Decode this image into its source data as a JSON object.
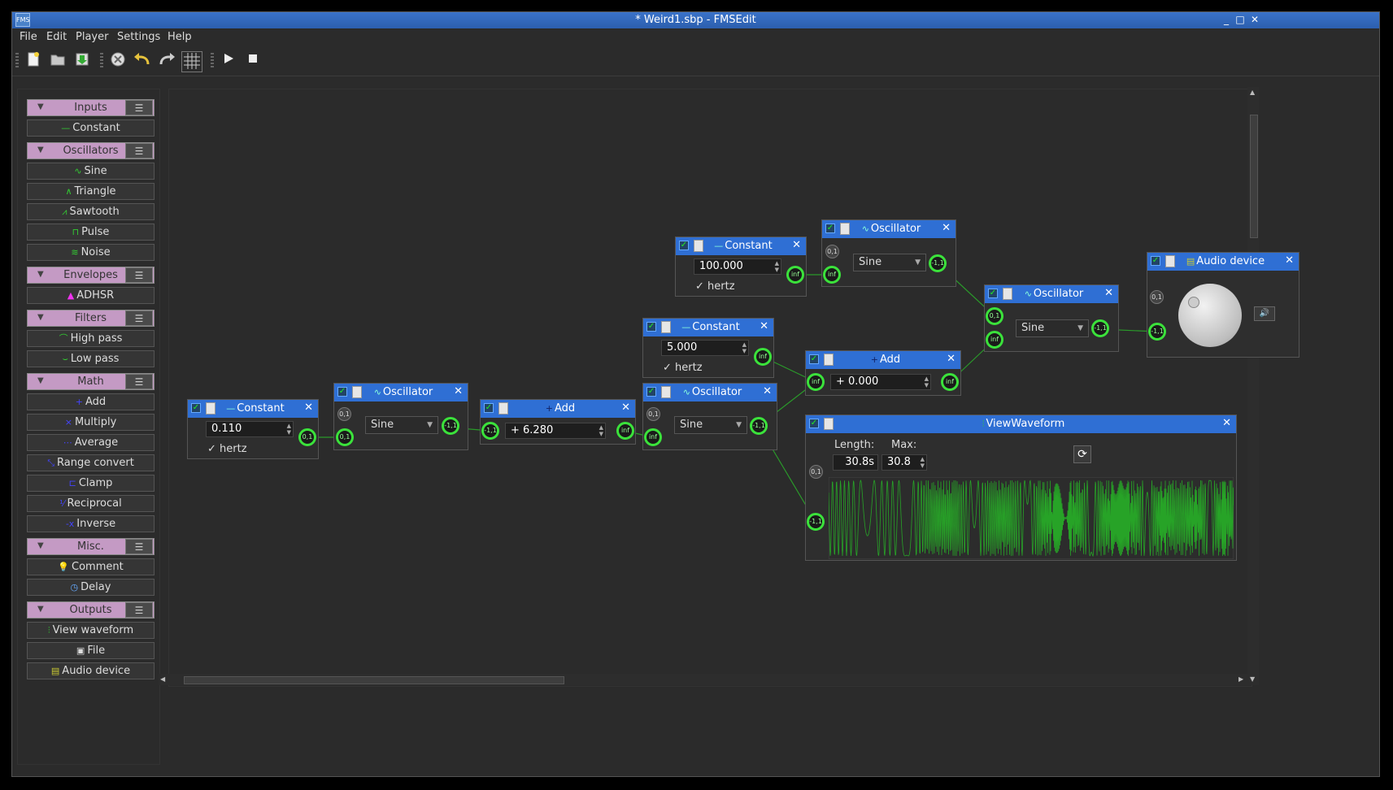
{
  "window": {
    "title": "* Weird1.sbp - FMSEdit",
    "app_icon": "fms-app-icon",
    "minimize": "_",
    "maximize": "□",
    "close": "✕"
  },
  "menu": [
    "File",
    "Edit",
    "Player",
    "Settings",
    "Help"
  ],
  "toolbar": {
    "icons": [
      "new-file-icon",
      "open-folder-icon",
      "save-icon",
      "delete-icon",
      "undo-icon",
      "redo-icon",
      "grid-icon",
      "play-icon",
      "stop-icon"
    ]
  },
  "sidebar": {
    "categories": [
      {
        "label": "Inputs",
        "items": [
          "Constant"
        ]
      },
      {
        "label": "Oscillators",
        "items": [
          "Sine",
          "Triangle",
          "Sawtooth",
          "Pulse",
          "Noise"
        ]
      },
      {
        "label": "Envelopes",
        "items": [
          "ADHSR"
        ]
      },
      {
        "label": "Filters",
        "items": [
          "High pass",
          "Low pass"
        ]
      },
      {
        "label": "Math",
        "items": [
          "Add",
          "Multiply",
          "Average",
          "Range convert",
          "Clamp",
          "Reciprocal",
          "Inverse"
        ]
      },
      {
        "label": "Misc.",
        "items": [
          "Comment",
          "Delay"
        ]
      },
      {
        "label": "Outputs",
        "items": [
          "View waveform",
          "File",
          "Audio device"
        ]
      }
    ]
  },
  "nodes": {
    "constant1": {
      "title": "Constant",
      "value": "0.110",
      "unit": "hertz",
      "out_port": "0,1"
    },
    "osc1": {
      "title": "Oscillator",
      "wave": "Sine",
      "in_port1": "0,1",
      "in_port2": "0,1",
      "out_port": "-1,1"
    },
    "add1": {
      "title": "Add",
      "value": "+ 6.280",
      "in_port": "-1,1",
      "out_port": "inf"
    },
    "constant2": {
      "title": "Constant",
      "value": "5.000",
      "unit": "hertz",
      "out_port": "inf"
    },
    "osc2": {
      "title": "Oscillator",
      "wave": "Sine",
      "in_port1": "0,1",
      "in_port2": "inf",
      "out_port": "-1,1"
    },
    "constant3": {
      "title": "Constant",
      "value": "100.000",
      "unit": "hertz",
      "out_port": "inf"
    },
    "osc3": {
      "title": "Oscillator",
      "wave": "Sine",
      "in_port1": "0,1",
      "in_port2": "inf",
      "out_port": "-1,1"
    },
    "add2": {
      "title": "Add",
      "value": "+ 0.000",
      "in_port": "inf",
      "out_port": "inf"
    },
    "osc4": {
      "title": "Oscillator",
      "wave": "Sine",
      "in_port1": "0,1",
      "in_port2": "inf",
      "out_port": "-1,1"
    },
    "audio": {
      "title": "Audio device",
      "in_port1": "0,1",
      "in_port2": "-1,1"
    },
    "waveform": {
      "title": "ViewWaveform",
      "length_label": "Length:",
      "max_label": "Max:",
      "length": "30.8s",
      "max": "30.8",
      "in_port1": "0,1",
      "in_port2": "-1,1"
    }
  },
  "colors": {
    "accent": "#2f6fd4",
    "category": "#c49ac4",
    "port": "#3be23b",
    "wire": "#2a9a2a",
    "wave": "#27a327"
  }
}
